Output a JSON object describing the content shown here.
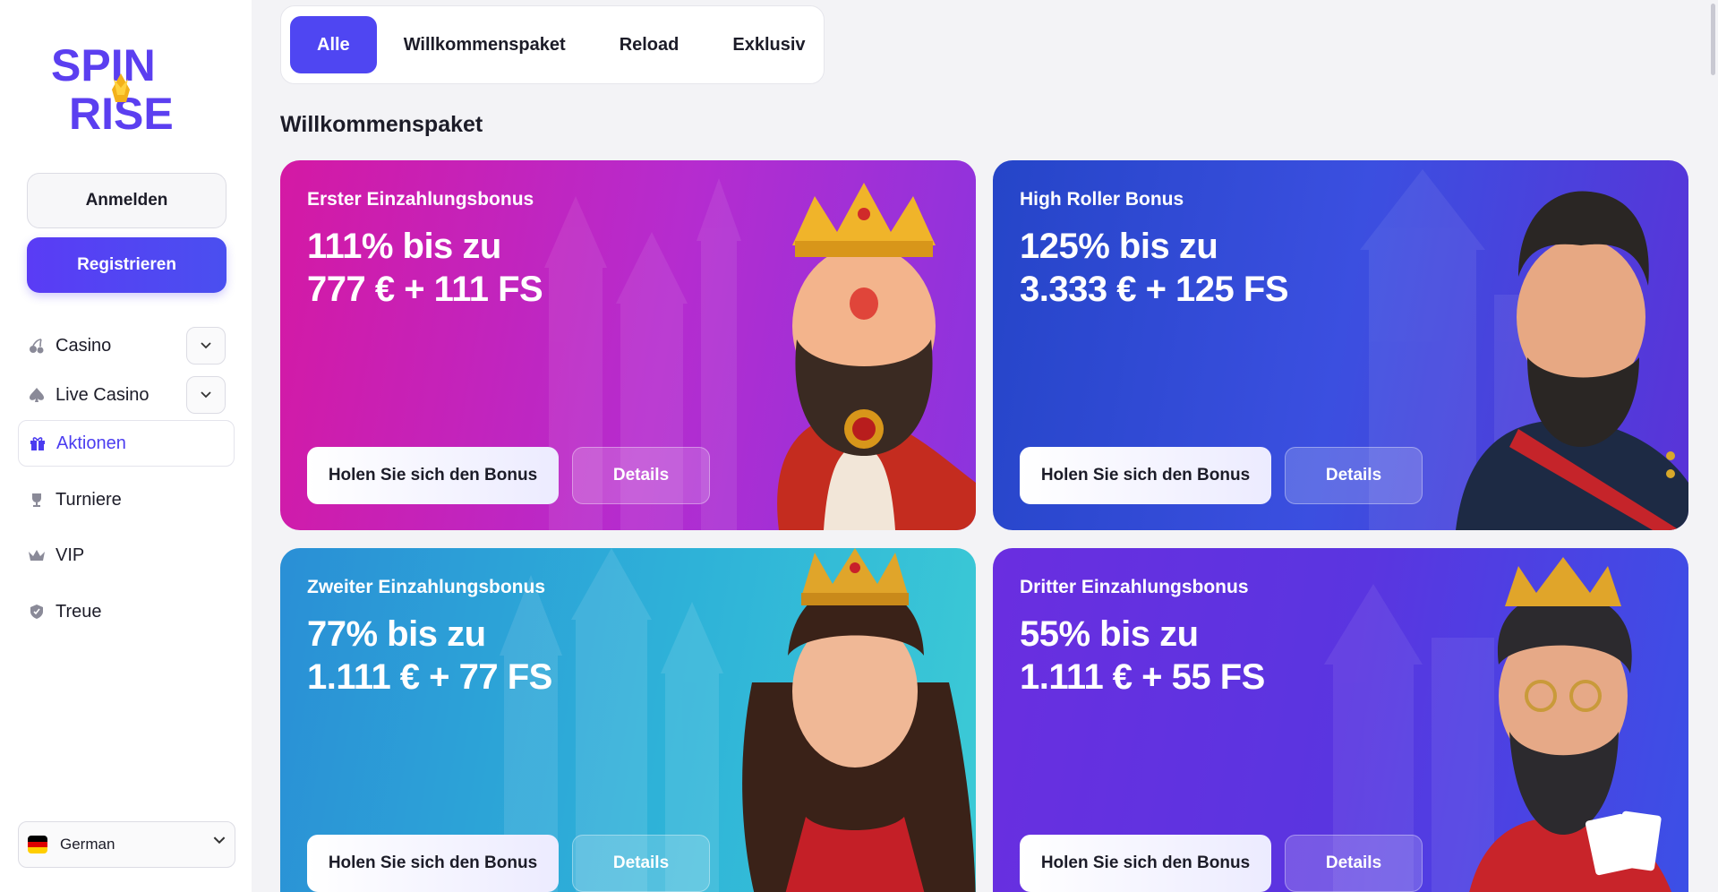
{
  "brand": {
    "logo_line1": "SPIN",
    "logo_line2": "RISE"
  },
  "auth": {
    "login_label": "Anmelden",
    "register_label": "Registrieren"
  },
  "nav": {
    "items": [
      {
        "label": "Casino",
        "icon": "cherries-icon",
        "has_dropdown": true
      },
      {
        "label": "Live Casino",
        "icon": "spade-icon",
        "has_dropdown": true
      },
      {
        "label": "Aktionen",
        "icon": "gift-icon",
        "active": true
      },
      {
        "label": "Turniere",
        "icon": "trophy-icon"
      },
      {
        "label": "VIP",
        "icon": "crown-icon"
      },
      {
        "label": "Treue",
        "icon": "shield-icon"
      }
    ]
  },
  "language": {
    "label": "German",
    "flag_colors": [
      "#000000",
      "#dd0000",
      "#ffce00"
    ]
  },
  "tabs": [
    {
      "label": "Alle",
      "active": true
    },
    {
      "label": "Willkommenspaket"
    },
    {
      "label": "Reload"
    },
    {
      "label": "Exklusiv"
    }
  ],
  "section_title": "Willkommenspaket",
  "cards": [
    {
      "subtitle": "Erster Einzahlungsbonus",
      "title_line1": "111% bis zu",
      "title_line2": "777 € + 111 FS",
      "claim_label": "Holen Sie sich den Bonus",
      "details_label": "Details",
      "colors": [
        "#d21aa8",
        "#9a2fd8"
      ]
    },
    {
      "subtitle": "High Roller Bonus",
      "title_line1": "125% bis zu",
      "title_line2": "3.333 € + 125 FS",
      "claim_label": "Holen Sie sich den Bonus",
      "details_label": "Details",
      "colors": [
        "#2a4fd6",
        "#5a2fd6"
      ]
    },
    {
      "subtitle": "Zweiter Einzahlungsbonus",
      "title_line1": "77% bis zu",
      "title_line2": "1.111 € + 77 FS",
      "claim_label": "Holen Sie sich den Bonus",
      "details_label": "Details",
      "colors": [
        "#2aa6d8",
        "#3bc6d8"
      ]
    },
    {
      "subtitle": "Dritter Einzahlungsbonus",
      "title_line1": "55% bis zu",
      "title_line2": "1.111 € + 55 FS",
      "claim_label": "Holen Sie sich den Bonus",
      "details_label": "Details",
      "colors": [
        "#6b2fe0",
        "#3b4fe6"
      ]
    }
  ]
}
